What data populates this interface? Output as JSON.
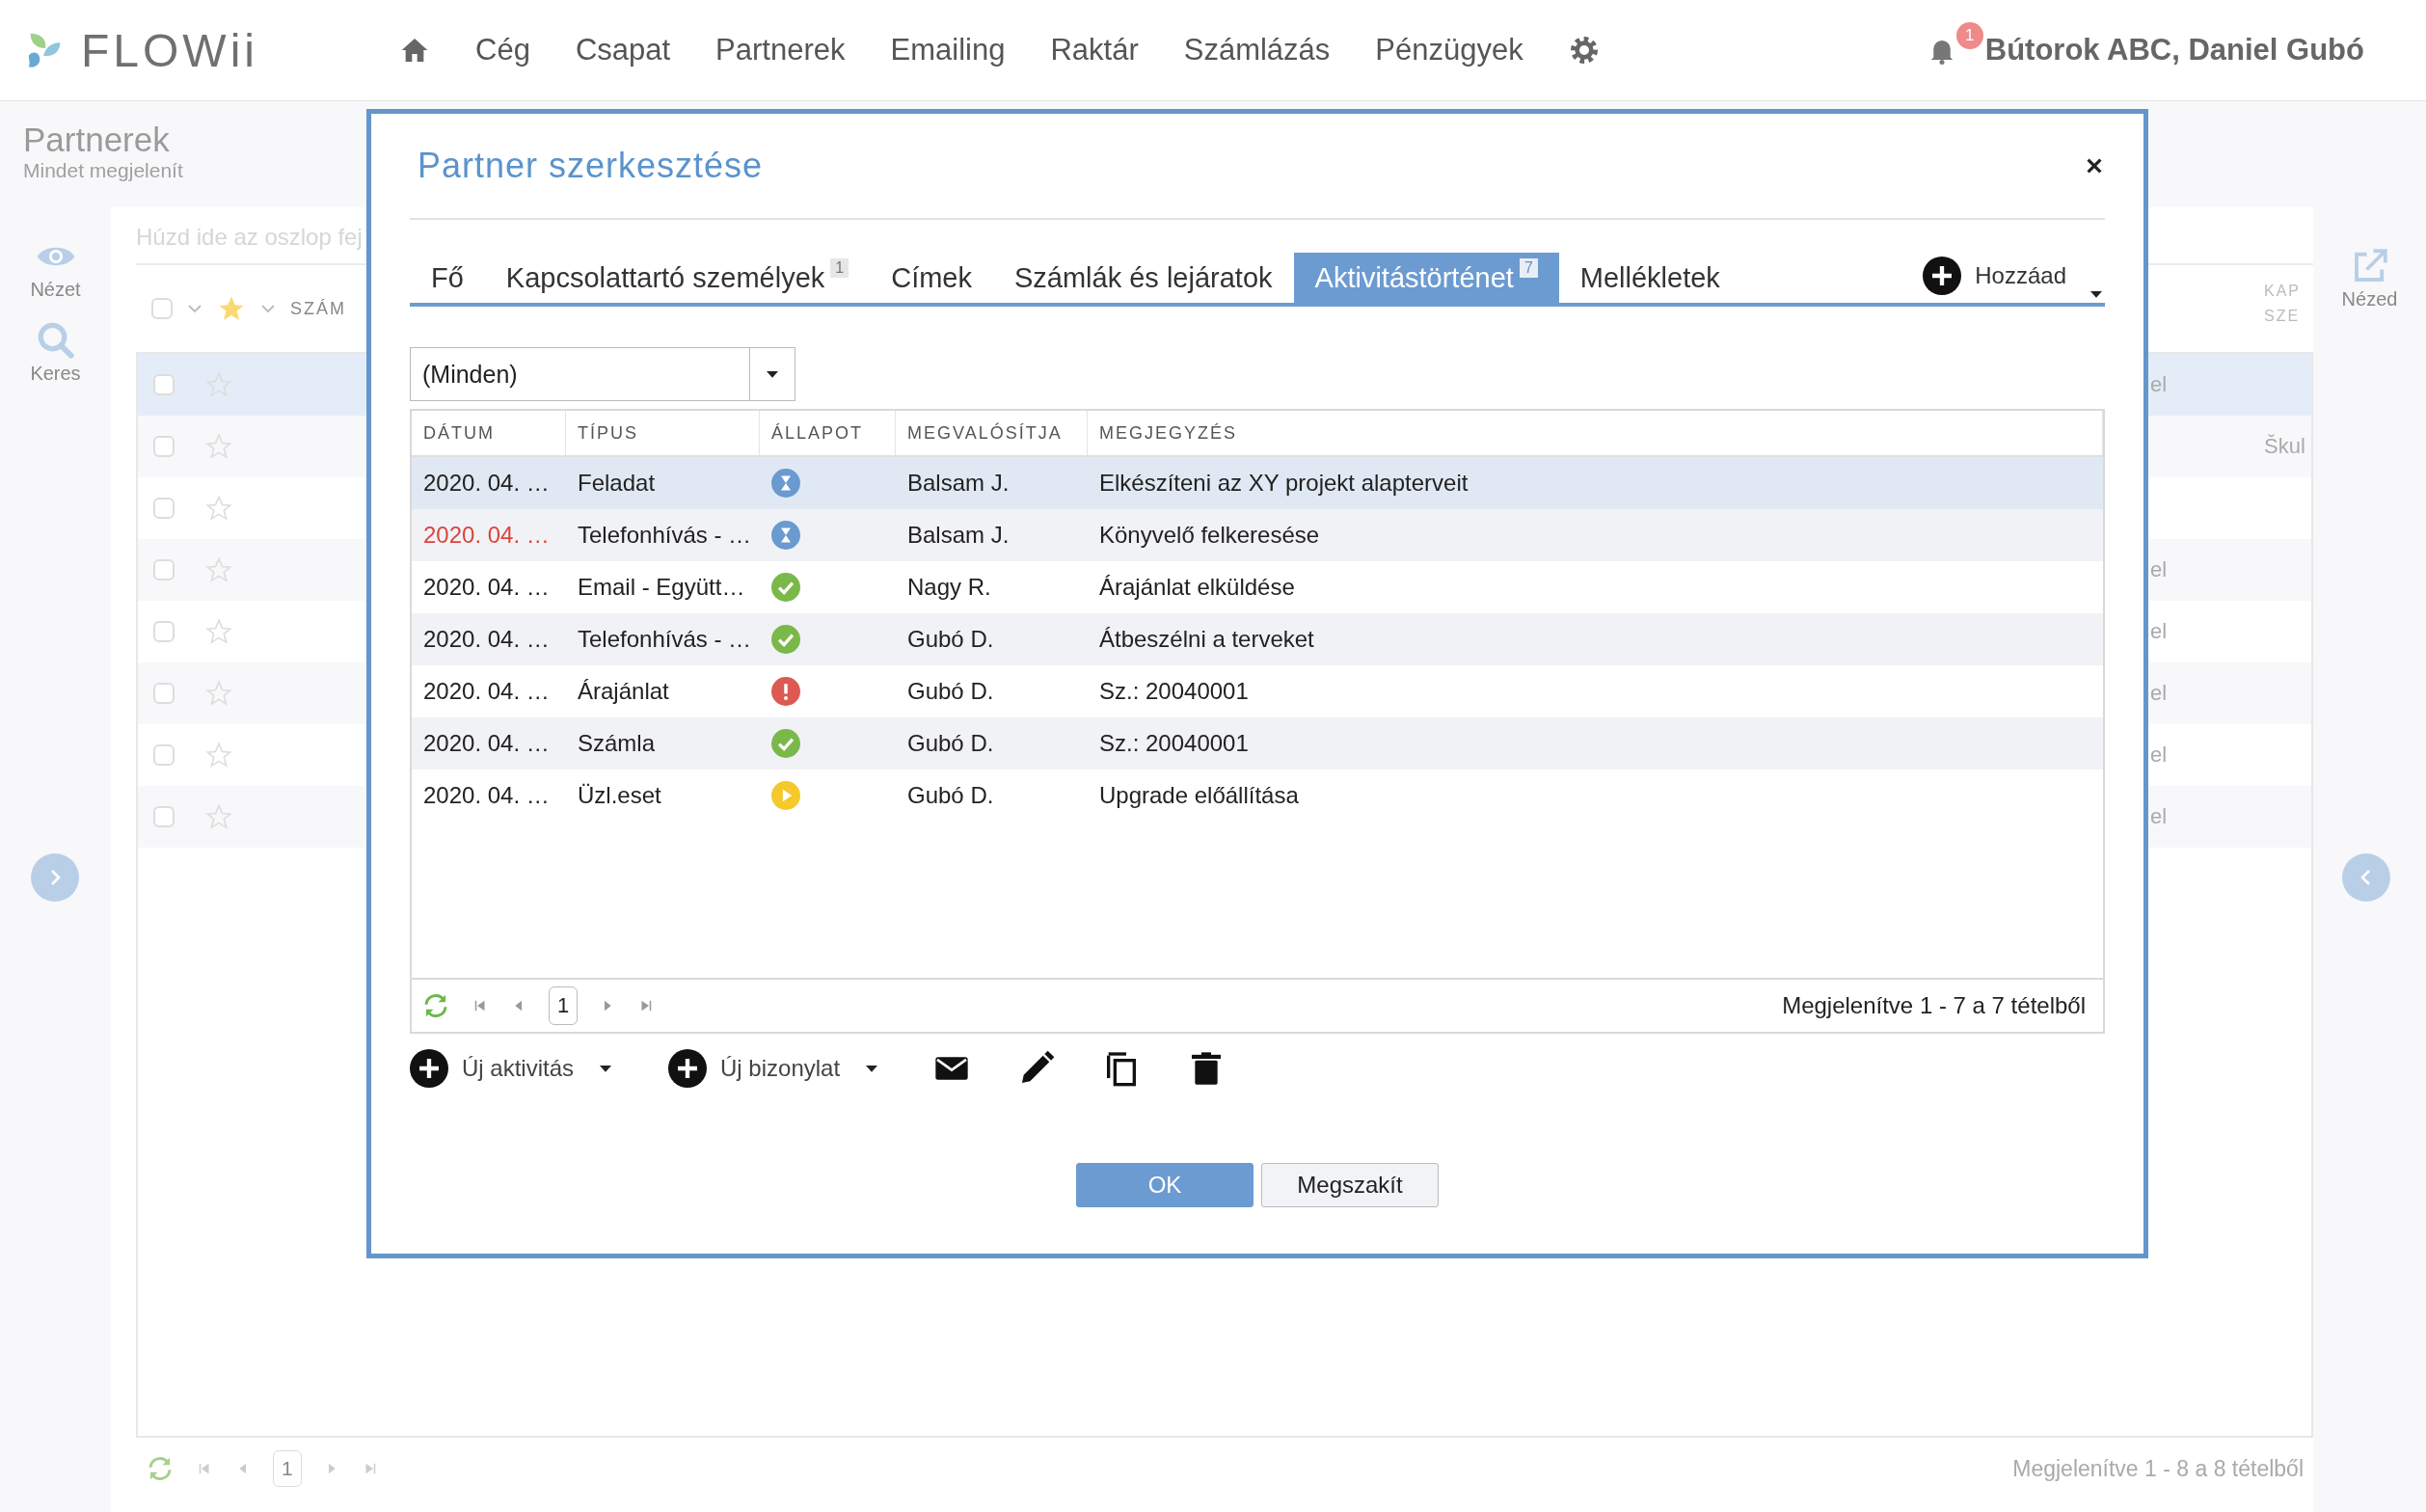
{
  "app": {
    "logo": "FLOWii",
    "nav": [
      "Cég",
      "Csapat",
      "Partnerek",
      "Emailing",
      "Raktár",
      "Számlázás",
      "Pénzügyek"
    ],
    "notifications": "1",
    "user": "Bútorok ABC, Daniel Gubó"
  },
  "page": {
    "title": "Partnerek",
    "subtitle": "Mindet megjelenít"
  },
  "left_toolbar": [
    {
      "label": "Nézet",
      "kind": "eye"
    },
    {
      "label": "Keres",
      "kind": "search"
    }
  ],
  "right_toolbar": [
    {
      "label": "Nézed",
      "kind": "open"
    }
  ],
  "grid": {
    "select_all_checked": false,
    "group_placeholder": "Húzd ide az oszlop fej",
    "column_1": "SZÁM",
    "column_2": [
      "KAP",
      "SZE"
    ],
    "rows": [
      {
        "selected": true,
        "cell_1": "el"
      },
      {
        "selected": false,
        "cell_2": "Škul"
      },
      {
        "selected": false
      },
      {
        "selected": false,
        "cell_1": "el"
      },
      {
        "selected": false,
        "cell_1": "el"
      },
      {
        "selected": false,
        "cell_1": "el"
      },
      {
        "selected": false,
        "cell_1": "el"
      },
      {
        "selected": false,
        "cell_1": "el"
      }
    ],
    "pager": {
      "page": "1",
      "summary": "Megjelenítve 1 - 8 a 8 tételből"
    }
  },
  "dialog": {
    "title": "Partner szerkesztése",
    "tabs": [
      {
        "label": "Fő",
        "selected": false
      },
      {
        "label": "Kapcsolattartó személyek",
        "badge": "1",
        "selected": false
      },
      {
        "label": "Címek",
        "selected": false
      },
      {
        "label": "Számlák és lejáratok",
        "selected": false
      },
      {
        "label": "Aktivitástörténet",
        "badge": "7",
        "selected": true
      },
      {
        "label": "Mellékletek",
        "selected": false
      }
    ],
    "add_button": "Hozzáad",
    "filter": {
      "value": "(Minden)"
    },
    "table": {
      "columns": [
        "DÁTUM",
        "TÍPUS",
        "ÁLLAPOT",
        "MEGVALÓSÍTJA",
        "MEGJEGYZÉS"
      ],
      "rows": [
        {
          "date": "2020. 04. …",
          "overdue": false,
          "type": "Feladat",
          "status": {
            "kind": "pending"
          },
          "owner": "Balsam J.",
          "note": "Elkészíteni az XY projekt alapterveit",
          "selected": true
        },
        {
          "date": "2020. 04. …",
          "overdue": true,
          "type": "Telefonhívás - …",
          "status": {
            "kind": "pending"
          },
          "owner": "Balsam J.",
          "note": "Könyvelő felkeresése",
          "selected": false
        },
        {
          "date": "2020. 04. …",
          "overdue": false,
          "type": "Email - Együtt…",
          "status": {
            "kind": "done"
          },
          "owner": "Nagy R.",
          "note": "Árajánlat elküldése",
          "selected": false
        },
        {
          "date": "2020. 04. …",
          "overdue": false,
          "type": "Telefonhívás - …",
          "status": {
            "kind": "done"
          },
          "owner": "Gubó D.",
          "note": "Átbeszélni a terveket",
          "selected": false
        },
        {
          "date": "2020. 04. …",
          "overdue": false,
          "type": "Árajánlat",
          "status": {
            "kind": "error"
          },
          "owner": "Gubó D.",
          "note": "Sz.: 20040001",
          "selected": false
        },
        {
          "date": "2020. 04. …",
          "overdue": false,
          "type": "Számla",
          "status": {
            "kind": "done"
          },
          "owner": "Gubó D.",
          "note": "Sz.: 20040001",
          "selected": false
        },
        {
          "date": "2020. 04. …",
          "overdue": false,
          "type": "Üzl.eset",
          "status": {
            "kind": "running"
          },
          "owner": "Gubó D.",
          "note": "Upgrade előállítása",
          "selected": false
        }
      ]
    },
    "pager": {
      "page": "1",
      "summary": "Megjelenítve 1 - 7 a 7 tételből"
    },
    "toolbar": {
      "new_activity": "Új aktivitás",
      "new_document": "Új bizonylat"
    },
    "buttons": [
      {
        "label": "OK",
        "kind": "primary"
      },
      {
        "label": "Megszakít",
        "kind": "secondary"
      }
    ]
  }
}
